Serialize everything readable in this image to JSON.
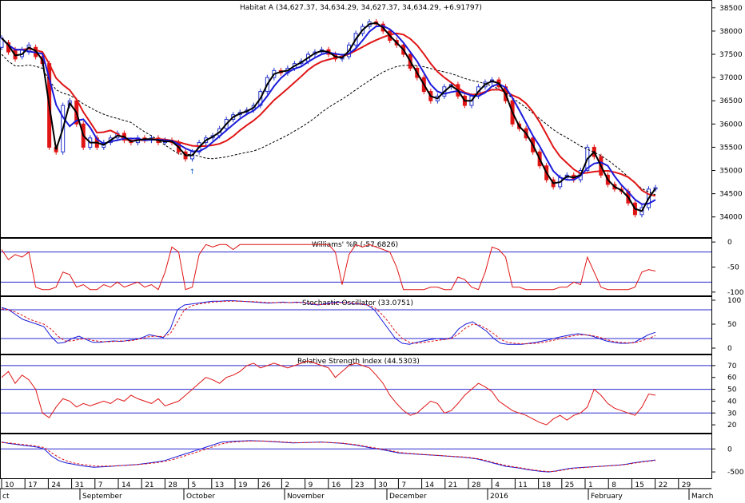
{
  "colors": {
    "up": "#2233cc",
    "down": "#e01515",
    "ma_fast": "#000000",
    "ma_mid": "#1a1adb",
    "ma_slow": "#e01515",
    "ma_long": "#000000",
    "ref_line": "#2a2ad0",
    "arrow": "#1560d0"
  },
  "chart_data": [
    {
      "type": "candlestick",
      "title": "Habitat A (34,627.37, 34,634.29, 34,627.37, 34,634.29, +6.91797)",
      "y_ticks": [
        "38500",
        "38000",
        "37500",
        "37000",
        "36500",
        "36000",
        "35500",
        "35000",
        "34500",
        "34000"
      ],
      "ylim": [
        33600,
        38600
      ],
      "closes": [
        37850,
        37550,
        37400,
        37600,
        37700,
        37450,
        37300,
        35500,
        35400,
        36400,
        36500,
        36000,
        35500,
        35700,
        35500,
        35600,
        35700,
        35800,
        35650,
        35600,
        35700,
        35650,
        35700,
        35600,
        35650,
        35600,
        35400,
        35250,
        35400,
        35600,
        35700,
        35750,
        35900,
        36100,
        36200,
        36250,
        36300,
        36400,
        36700,
        37000,
        37150,
        37100,
        37200,
        37300,
        37350,
        37500,
        37550,
        37600,
        37500,
        37400,
        37450,
        37700,
        37950,
        38100,
        38200,
        38150,
        38000,
        37800,
        37700,
        37500,
        37200,
        37000,
        36700,
        36500,
        36600,
        36800,
        36850,
        36600,
        36400,
        36600,
        36800,
        36900,
        36950,
        36800,
        36500,
        36000,
        35900,
        35700,
        35400,
        35100,
        34800,
        34650,
        34850,
        34900,
        34800,
        35000,
        35500,
        35300,
        34900,
        34700,
        34600,
        34550,
        34300,
        34050,
        34200,
        34600,
        34630
      ],
      "opens": [
        37650,
        37750,
        37600,
        37450,
        37550,
        37650,
        37450,
        37300,
        35500,
        35400,
        36400,
        36500,
        36000,
        35500,
        35700,
        35500,
        35600,
        35700,
        35800,
        35650,
        35600,
        35700,
        35650,
        35700,
        35600,
        35650,
        35600,
        35400,
        35250,
        35400,
        35600,
        35700,
        35750,
        35900,
        36100,
        36200,
        36250,
        36300,
        36400,
        36700,
        37000,
        37150,
        37100,
        37200,
        37300,
        37350,
        37500,
        37550,
        37600,
        37500,
        37400,
        37450,
        37700,
        37950,
        38100,
        38200,
        38150,
        38000,
        37800,
        37700,
        37500,
        37200,
        37000,
        36700,
        36500,
        36600,
        36800,
        36850,
        36600,
        36400,
        36600,
        36800,
        36900,
        36950,
        36800,
        36500,
        36000,
        35900,
        35700,
        35400,
        35100,
        34800,
        34650,
        34850,
        34900,
        34800,
        35000,
        35500,
        35300,
        34900,
        34700,
        34600,
        34550,
        34300,
        34050,
        34200,
        34600
      ],
      "marker": {
        "index": 28,
        "symbol": "↑"
      },
      "series": []
    },
    {
      "type": "line",
      "title": "Williams' %R (-57.6826)",
      "y_ticks": [
        "0",
        "-50",
        "-100"
      ],
      "ylim": [
        -105,
        5
      ],
      "ref_lines": [
        -20,
        -80
      ],
      "values": [
        -15,
        -35,
        -25,
        -30,
        -20,
        -90,
        -95,
        -95,
        -90,
        -60,
        -65,
        -90,
        -85,
        -95,
        -95,
        -85,
        -90,
        -80,
        -90,
        -85,
        -80,
        -90,
        -85,
        -95,
        -60,
        -10,
        -20,
        -95,
        -90,
        -25,
        -5,
        -10,
        -5,
        -5,
        -15,
        -5,
        -5,
        -5,
        -5,
        -5,
        -5,
        -5,
        -5,
        -5,
        -5,
        -5,
        -5,
        -5,
        -5,
        -20,
        -85,
        -25,
        -5,
        -10,
        -5,
        -10,
        -15,
        -20,
        -50,
        -95,
        -95,
        -95,
        -95,
        -90,
        -90,
        -95,
        -95,
        -70,
        -75,
        -90,
        -95,
        -60,
        -10,
        -15,
        -30,
        -90,
        -90,
        -95,
        -95,
        -95,
        -95,
        -95,
        -90,
        -90,
        -80,
        -85,
        -30,
        -60,
        -90,
        -95,
        -95,
        -95,
        -95,
        -90,
        -60,
        -55,
        -58
      ]
    },
    {
      "type": "line",
      "title": "Stochastic Oscillator (33.0751)",
      "y_ticks": [
        "100",
        "50",
        "0"
      ],
      "ylim": [
        -10,
        105
      ],
      "ref_lines": [
        80,
        20
      ],
      "series": [
        {
          "values": [
            85,
            80,
            70,
            60,
            55,
            50,
            45,
            25,
            10,
            12,
            20,
            25,
            18,
            12,
            12,
            14,
            15,
            14,
            16,
            18,
            22,
            28,
            25,
            22,
            40,
            80,
            90,
            92,
            94,
            96,
            98,
            98,
            99,
            99,
            98,
            97,
            96,
            95,
            94,
            95,
            96,
            95,
            96,
            95,
            92,
            90,
            92,
            95,
            96,
            95,
            93,
            92,
            90,
            80,
            60,
            40,
            20,
            10,
            8,
            12,
            15,
            18,
            20,
            18,
            22,
            40,
            50,
            55,
            45,
            35,
            20,
            10,
            8,
            8,
            8,
            10,
            12,
            15,
            18,
            22,
            25,
            28,
            30,
            28,
            25,
            20,
            15,
            12,
            10,
            10,
            12,
            20,
            28,
            33
          ]
        },
        {
          "values": [
            82,
            80,
            75,
            68,
            60,
            55,
            50,
            40,
            25,
            15,
            15,
            18,
            20,
            16,
            14,
            13,
            14,
            15,
            15,
            17,
            20,
            24,
            25,
            24,
            30,
            55,
            80,
            88,
            92,
            94,
            96,
            97,
            98,
            98,
            98,
            97,
            97,
            96,
            95,
            95,
            95,
            95,
            95,
            95,
            93,
            91,
            91,
            93,
            95,
            95,
            94,
            92,
            90,
            85,
            72,
            55,
            35,
            20,
            12,
            10,
            12,
            14,
            16,
            18,
            20,
            30,
            42,
            50,
            48,
            40,
            30,
            18,
            12,
            10,
            9,
            9,
            10,
            12,
            15,
            18,
            22,
            25,
            27,
            28,
            26,
            23,
            18,
            14,
            12,
            11,
            11,
            15,
            20,
            26
          ]
        }
      ]
    },
    {
      "type": "line",
      "title": "Relative Strength Index (44.5303)",
      "y_ticks": [
        "70",
        "60",
        "50",
        "40",
        "30",
        "20"
      ],
      "ylim": [
        14,
        78
      ],
      "ref_lines": [
        70,
        50,
        30
      ],
      "values": [
        60,
        65,
        55,
        62,
        58,
        50,
        30,
        26,
        35,
        42,
        40,
        35,
        38,
        36,
        38,
        40,
        38,
        42,
        40,
        45,
        42,
        40,
        38,
        42,
        36,
        38,
        40,
        45,
        50,
        55,
        60,
        58,
        55,
        60,
        62,
        65,
        70,
        72,
        68,
        70,
        72,
        70,
        68,
        70,
        72,
        74,
        72,
        70,
        68,
        60,
        65,
        70,
        72,
        70,
        68,
        62,
        55,
        45,
        38,
        32,
        28,
        30,
        35,
        40,
        38,
        30,
        32,
        38,
        45,
        50,
        55,
        52,
        48,
        40,
        36,
        32,
        30,
        28,
        25,
        22,
        20,
        25,
        28,
        24,
        28,
        30,
        35,
        50,
        45,
        38,
        34,
        32,
        30,
        28,
        35,
        46,
        45
      ]
    },
    {
      "type": "line",
      "title": "",
      "y_ticks": [
        "0",
        "-500"
      ],
      "ylim": [
        -620,
        300
      ],
      "ref_lines": [
        0
      ],
      "series": [
        {
          "values": [
            150,
            120,
            100,
            80,
            60,
            40,
            0,
            -150,
            -250,
            -300,
            -330,
            -360,
            -380,
            -400,
            -390,
            -380,
            -370,
            -360,
            -350,
            -340,
            -320,
            -300,
            -280,
            -250,
            -200,
            -150,
            -100,
            -50,
            0,
            50,
            100,
            150,
            160,
            170,
            175,
            180,
            175,
            170,
            160,
            150,
            140,
            130,
            135,
            140,
            145,
            150,
            140,
            130,
            120,
            100,
            80,
            50,
            20,
            0,
            -30,
            -60,
            -90,
            -100,
            -110,
            -120,
            -130,
            -140,
            -150,
            -160,
            -170,
            -180,
            -200,
            -220,
            -260,
            -300,
            -340,
            -380,
            -400,
            -420,
            -450,
            -470,
            -490,
            -500,
            -480,
            -450,
            -420,
            -410,
            -400,
            -390,
            -380,
            -370,
            -360,
            -350,
            -330,
            -300,
            -280,
            -260,
            -240
          ]
        },
        {
          "values": [
            140,
            130,
            110,
            95,
            80,
            60,
            30,
            -80,
            -180,
            -250,
            -300,
            -330,
            -350,
            -370,
            -375,
            -372,
            -368,
            -360,
            -352,
            -342,
            -328,
            -312,
            -295,
            -270,
            -235,
            -190,
            -140,
            -90,
            -40,
            10,
            60,
            110,
            140,
            155,
            165,
            172,
            174,
            172,
            166,
            158,
            148,
            138,
            135,
            138,
            142,
            146,
            142,
            134,
            124,
            108,
            88,
            62,
            34,
            10,
            -15,
            -45,
            -75,
            -92,
            -104,
            -115,
            -126,
            -136,
            -146,
            -156,
            -166,
            -176,
            -192,
            -210,
            -245,
            -285,
            -325,
            -362,
            -388,
            -410,
            -438,
            -460,
            -480,
            -492,
            -484,
            -460,
            -432,
            -416,
            -404,
            -393,
            -383,
            -373,
            -363,
            -352,
            -335,
            -310,
            -288,
            -268,
            -250
          ]
        }
      ]
    }
  ],
  "x_axis": {
    "day_ticks": [
      "10",
      "17",
      "24",
      "31",
      "7",
      "14",
      "21",
      "28",
      "5",
      "13",
      "19",
      "26",
      "2",
      "9",
      "16",
      "23",
      "30",
      "7",
      "14",
      "21",
      "28",
      "4",
      "11",
      "18",
      "25",
      "1",
      "8",
      "15",
      "22",
      "29"
    ],
    "month_labels": [
      "ct",
      "September",
      "October",
      "November",
      "December",
      "2016",
      "February",
      "March"
    ]
  }
}
